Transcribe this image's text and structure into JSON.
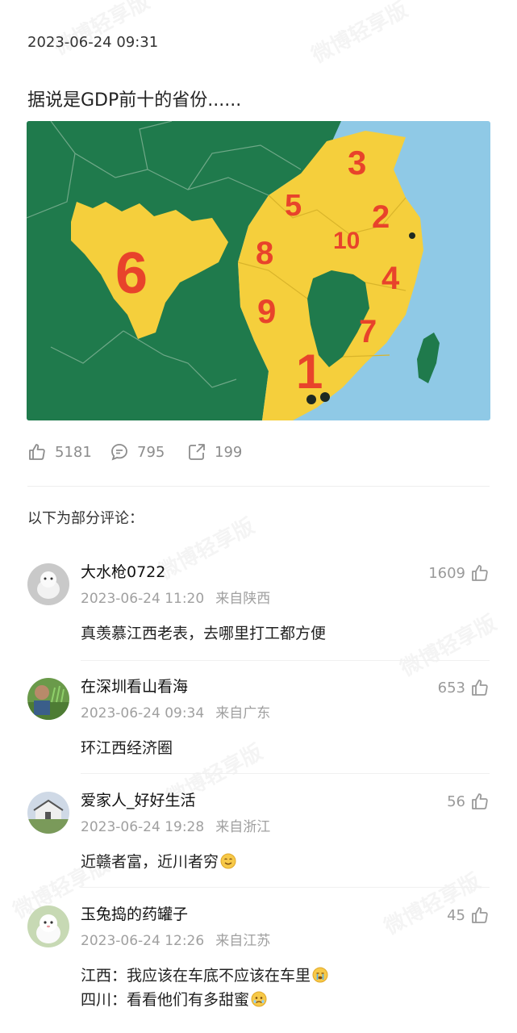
{
  "post": {
    "time": "2023-06-24 09:31",
    "text": "据说是GDP前十的省份......"
  },
  "map": {
    "labels": [
      "1",
      "2",
      "3",
      "4",
      "5",
      "6",
      "7",
      "8",
      "9",
      "10"
    ],
    "colors": {
      "sea": "#8fc9e6",
      "land": "#1f7a4c",
      "highlight": "#f5cf3c",
      "label": "#e8432b"
    }
  },
  "stats": {
    "likes": "5181",
    "comments": "795",
    "reposts": "199"
  },
  "comments_header": "以下为部分评论：",
  "comments": [
    {
      "name": "大水枪0722",
      "time": "2023-06-24 11:20",
      "location": "来自陕西",
      "likes": "1609",
      "text": "真羡慕江西老表，去哪里打工都方便"
    },
    {
      "name": "在深圳看山看海",
      "time": "2023-06-24 09:34",
      "location": "来自广东",
      "likes": "653",
      "text": "环江西经济圈"
    },
    {
      "name": "爱家人_好好生活",
      "time": "2023-06-24 19:28",
      "location": "来自浙江",
      "likes": "56",
      "text": "近赣者富，近川者穷"
    },
    {
      "name": "玉兔捣的药罐子",
      "time": "2023-06-24 12:26",
      "location": "来自江苏",
      "likes": "45",
      "text": "江西：我应该在车底不应该在车里",
      "text2": "四川：看看他们有多甜蜜"
    }
  ],
  "watermark": "微博轻享版",
  "accent": "#f5cf3c"
}
